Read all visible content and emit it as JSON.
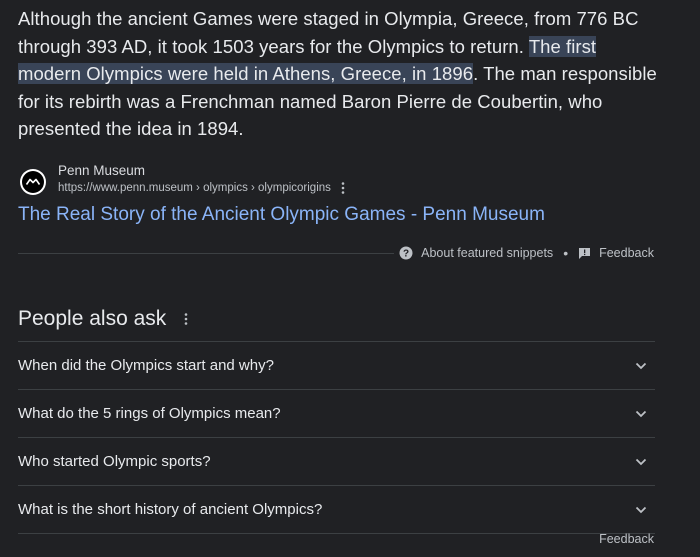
{
  "snippet": {
    "text_before": "Although the ancient Games were staged in Olympia, Greece, from 776 BC through 393 AD, it took 1503 years for the Olympics to return. ",
    "text_highlight": "The first modern Olympics were held in Athens, Greece, in 1896",
    "text_after": ". The man responsible for its rebirth was a Frenchman named Baron Pierre de Coubertin, who presented the idea in 1894."
  },
  "source": {
    "favicon_icon": "penn-museum-logo-icon",
    "site_name": "Penn Museum",
    "url": "https://www.penn.museum › olympics › olympicorigins",
    "more_icon": "vertical-dots-icon"
  },
  "result": {
    "title": "The Real Story of the Ancient Olympic Games - Penn Museum"
  },
  "snippet_footer": {
    "about_label": "About featured snippets",
    "about_icon": "help-circle-icon",
    "bullet": "•",
    "feedback_label": "Feedback",
    "feedback_icon": "feedback-flag-icon"
  },
  "people_also_ask": {
    "heading": "People also ask",
    "more_icon": "vertical-dots-icon",
    "questions": [
      "When did the Olympics start and why?",
      "What do the 5 rings of Olympics mean?",
      "Who started Olympic sports?",
      "What is the short history of ancient Olympics?"
    ],
    "chevron_icon": "chevron-down-icon",
    "feedback_label": "Feedback"
  },
  "colors": {
    "background": "#202124",
    "text": "#e8eaed",
    "link": "#8ab4f8",
    "highlight": "#394457",
    "divider": "#3c4043"
  }
}
